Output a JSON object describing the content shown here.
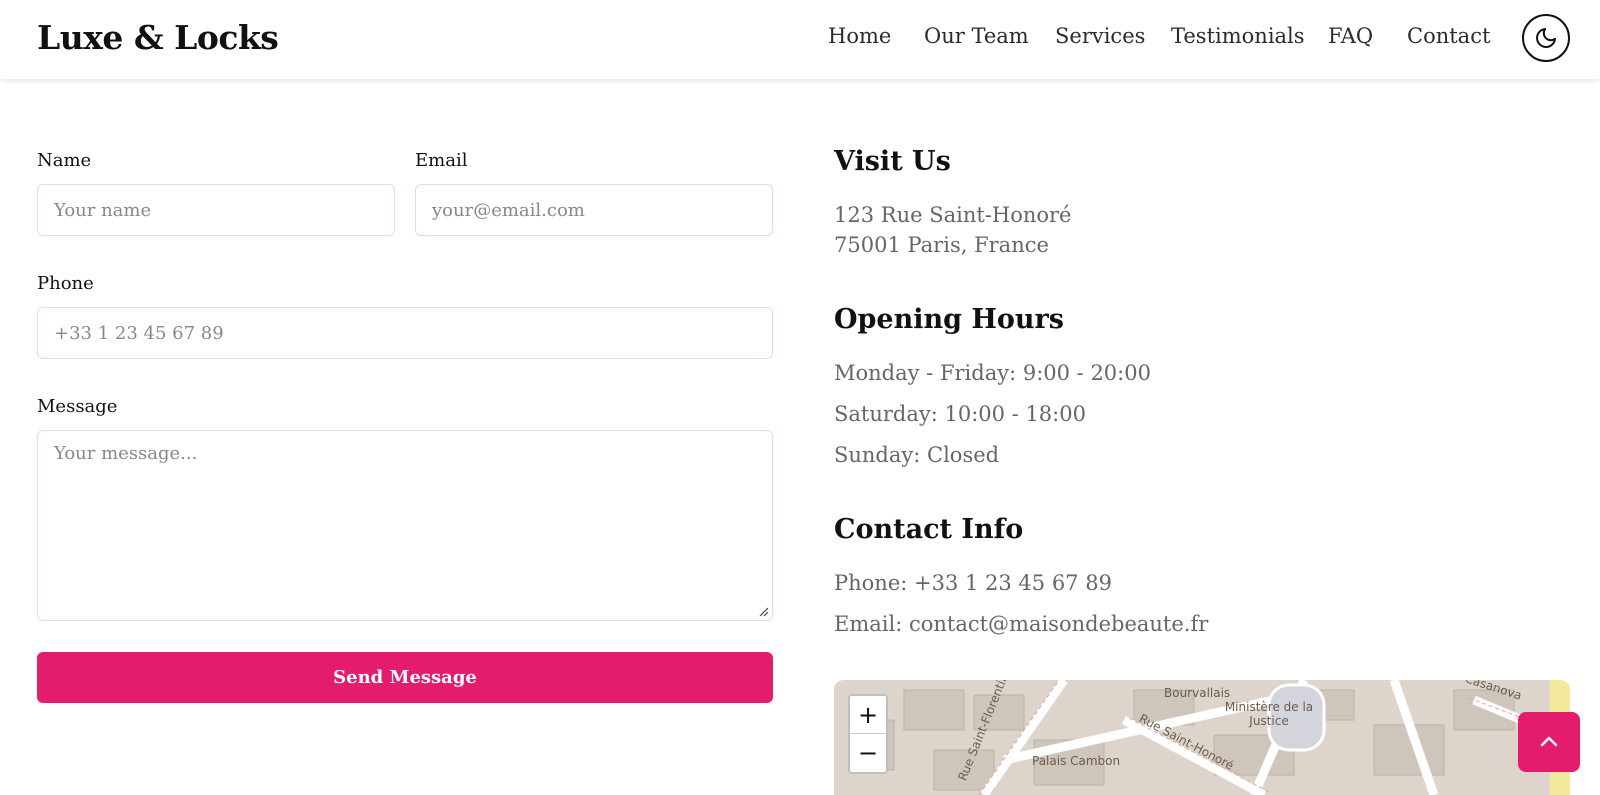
{
  "brand": {
    "logo": "Luxe & Locks"
  },
  "nav": [
    {
      "label": "Home"
    },
    {
      "label": "Our Team"
    },
    {
      "label": "Services"
    },
    {
      "label": "Testimonials"
    },
    {
      "label": "FAQ"
    },
    {
      "label": "Contact"
    }
  ],
  "theme_toggle": {
    "icon": "moon-icon"
  },
  "form": {
    "name": {
      "label": "Name",
      "placeholder": "Your name"
    },
    "email": {
      "label": "Email",
      "placeholder": "your@email.com"
    },
    "phone": {
      "label": "Phone",
      "placeholder": "+33 1 23 45 67 89"
    },
    "message": {
      "label": "Message",
      "placeholder": "Your message..."
    },
    "submit_label": "Send Message"
  },
  "visit": {
    "heading": "Visit Us",
    "address_line1": "123 Rue Saint-Honoré",
    "address_line2": "75001 Paris, France"
  },
  "hours": {
    "heading": "Opening Hours",
    "lines": [
      "Monday - Friday: 9:00 - 20:00",
      "Saturday: 10:00 - 18:00",
      "Sunday: Closed"
    ]
  },
  "contact": {
    "heading": "Contact Info",
    "phone": "Phone: +33 1 23 45 67 89",
    "email": "Email: contact@maisondebeaute.fr"
  },
  "map": {
    "zoom_in": "+",
    "zoom_out": "−",
    "labels": [
      "Bourvallais",
      "Ministère de la Justice",
      "Rue Saint-Honoré",
      "Palais Cambon",
      "Rue Saint-Florentin",
      "Casanova"
    ]
  },
  "colors": {
    "accent": "#e31c6e",
    "border": "#f6d3df"
  }
}
